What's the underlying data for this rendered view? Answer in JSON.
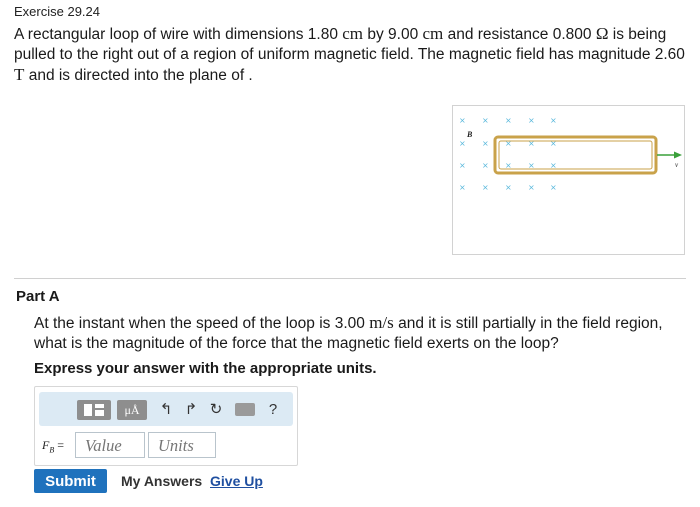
{
  "exercise": {
    "title": "Exercise 29.24"
  },
  "problem": {
    "s1": "A rectangular loop of wire with dimensions 1.80 ",
    "u1": "cm",
    "s2": " by 9.00 ",
    "u2": "cm",
    "s3": " and resistance 0.800 ",
    "u3": "Ω",
    "s4": " is being pulled to the right out of a region of uniform magnetic field. The magnetic field has magnitude 2.60 ",
    "u4": "T",
    "s5": " and is directed into the plane of ."
  },
  "figure": {
    "field_label": "B",
    "velocity_label": "v",
    "field_mark": "×",
    "colors": {
      "field_mark": "#5ab8dc",
      "loop": "#c9a24a",
      "arrow": "#3aa03a"
    }
  },
  "part": {
    "title": "Part A",
    "q1": "At the instant when the speed of the loop is 3.00 ",
    "qu": "m/s",
    "q2": " and it is still partially in the field region, what is the magnitude of the force that the magnetic field exerts on the loop?",
    "instruction": "Express your answer with the appropriate units."
  },
  "answer": {
    "toolbar": {
      "units_button": "μÅ",
      "undo_icon": "↰",
      "redo_icon": "↱",
      "reset_icon": "↻",
      "help_label": "?"
    },
    "label_main": "F",
    "label_sub": "B",
    "label_eq": " =",
    "value_placeholder": "Value",
    "units_placeholder": "Units"
  },
  "actions": {
    "submit": "Submit",
    "my_answers": "My Answers",
    "give_up": "Give Up"
  },
  "colors": {
    "accent": "#1f72bd",
    "toolbar_bg": "#dceaf4",
    "link": "#1f4fa0"
  }
}
